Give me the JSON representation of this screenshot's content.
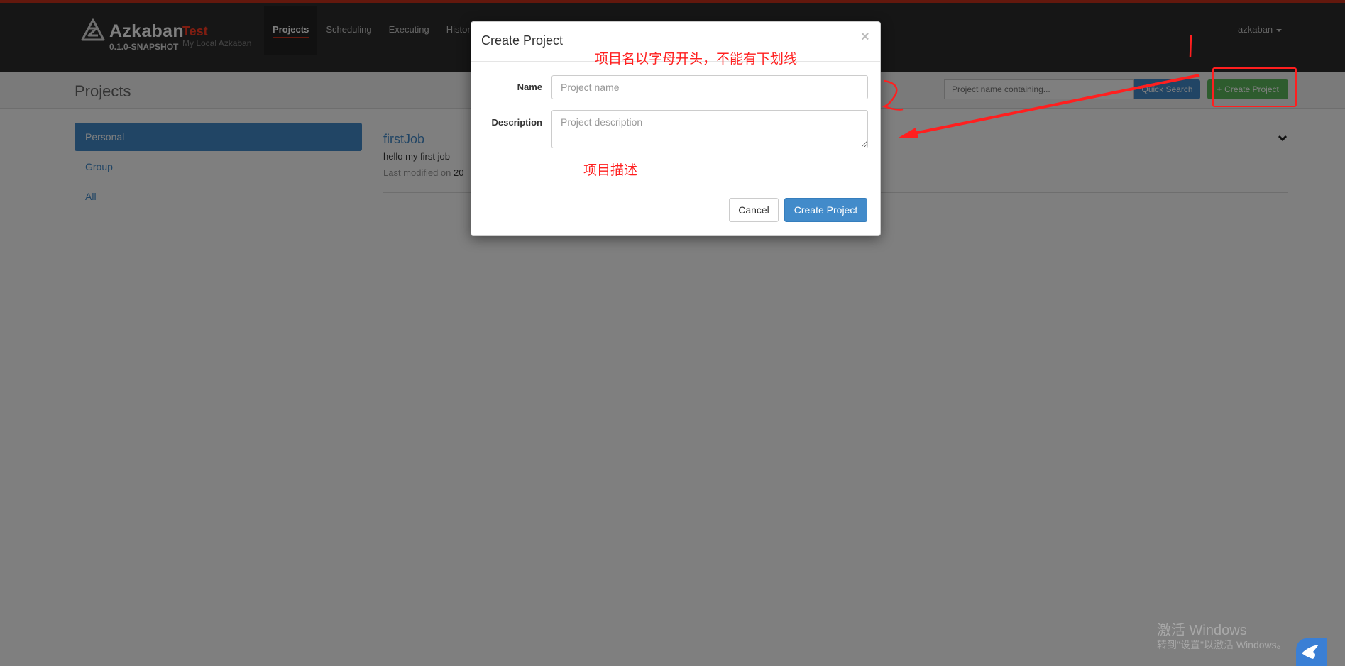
{
  "navbar": {
    "brand": "Azkaban",
    "version": "0.1.0-SNAPSHOT",
    "env_name": "Test",
    "env_desc": "My Local Azkaban",
    "tabs": [
      {
        "label": "Projects",
        "active": true
      },
      {
        "label": "Scheduling",
        "active": false
      },
      {
        "label": "Executing",
        "active": false
      },
      {
        "label": "History",
        "active": false
      }
    ],
    "user": "azkaban"
  },
  "header": {
    "title": "Projects",
    "search_placeholder": "Project name containing...",
    "quick_search_label": "Quick Search",
    "create_project_label": "Create Project"
  },
  "sidebar": {
    "items": [
      {
        "label": "Personal",
        "active": true
      },
      {
        "label": "Group",
        "active": false
      },
      {
        "label": "All",
        "active": false
      }
    ]
  },
  "projects": [
    {
      "name": "firstJob",
      "description": "hello my first job",
      "modified_label": "Last modified on",
      "modified_value": "20"
    }
  ],
  "modal": {
    "title": "Create Project",
    "close_glyph": "×",
    "name_label": "Name",
    "name_placeholder": "Project name",
    "description_label": "Description",
    "description_placeholder": "Project description",
    "cancel_label": "Cancel",
    "create_label": "Create Project"
  },
  "annotations": {
    "name_note": "项目名以字母开头，不能有下划线",
    "desc_note": "项目描述",
    "step1": "1",
    "step2": "2",
    "color": "#ff1f1f"
  },
  "watermark": {
    "title": "激活 Windows",
    "subtitle": "转到\"设置\"以激活 Windows。"
  },
  "colors": {
    "accent": "#c7301b",
    "primary": "#428bca",
    "success": "#5cb85c",
    "navbar": "#2d2d2d"
  }
}
